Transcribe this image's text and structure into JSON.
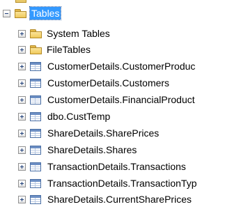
{
  "tree": {
    "root": {
      "label": "Tables",
      "expanded": true,
      "selected": true,
      "icon": "folder-icon"
    },
    "children": [
      {
        "label": "System Tables",
        "icon": "folder-icon",
        "expanded": false
      },
      {
        "label": "FileTables",
        "icon": "folder-icon",
        "expanded": false
      },
      {
        "label": "CustomerDetails.CustomerProduc",
        "icon": "table-icon",
        "expanded": false
      },
      {
        "label": "CustomerDetails.Customers",
        "icon": "table-icon",
        "expanded": false
      },
      {
        "label": "CustomerDetails.FinancialProduct",
        "icon": "table-icon",
        "expanded": false
      },
      {
        "label": "dbo.CustTemp",
        "icon": "table-icon",
        "expanded": false
      },
      {
        "label": "ShareDetails.SharePrices",
        "icon": "table-icon",
        "expanded": false
      },
      {
        "label": "ShareDetails.Shares",
        "icon": "table-icon",
        "expanded": false
      },
      {
        "label": "TransactionDetails.Transactions",
        "icon": "table-icon",
        "expanded": false
      },
      {
        "label": "TransactionDetails.TransactionTyp",
        "icon": "table-icon",
        "expanded": false
      },
      {
        "label": "ShareDetails.CurrentSharePrices",
        "icon": "table-icon",
        "expanded": false
      }
    ]
  },
  "colors": {
    "selection_background": "#3399ff",
    "selection_text": "#ffffff",
    "folder": "#efc95b",
    "table_icon": "#6d8fc4"
  }
}
